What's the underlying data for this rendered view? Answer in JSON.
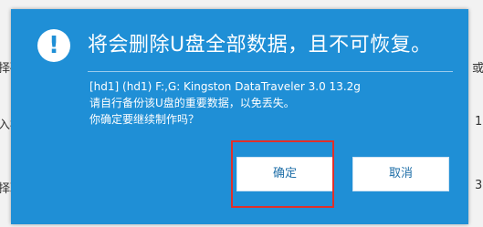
{
  "background": {
    "left_fragments": [
      "择磁",
      "入检",
      "择职"
    ],
    "right_fragments": [
      "或",
      "1",
      "3"
    ]
  },
  "dialog": {
    "icon": "exclamation-icon",
    "icon_glyph": "!",
    "title": "将会删除U盘全部数据，且不可恢复。",
    "message_line_1": "[hd1] (hd1) F:,G: Kingston DataTraveler 3.0 13.2g",
    "message_line_2": "请自行备份该U盘的重要数据，以免丢失。",
    "message_line_3": "你确定要继续制作吗？",
    "confirm_label": "确定",
    "cancel_label": "取消"
  },
  "colors": {
    "dialog_blue": "#1f8fd6",
    "highlight_red": "#e0302a"
  }
}
